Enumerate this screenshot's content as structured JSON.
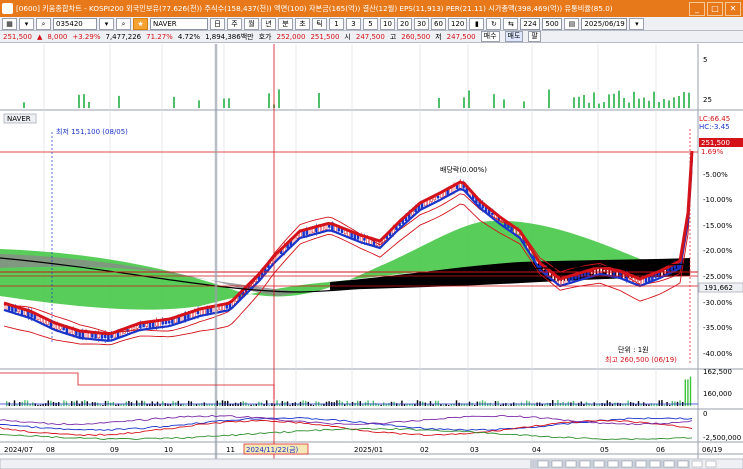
{
  "window": {
    "title": "[0600] 키움종합차트 - KOSPI200 외국인보유(77.626(천)) 주식수(158,437(천)) 액면(100) 자본금(165(억)) 결산(12월) EPS(11,913) PER(21.11) 시가총액(398,469(억)) 유통비율(85.0)",
    "buttons": [
      "_",
      "□",
      "✕"
    ]
  },
  "toolbar": {
    "code": "035420",
    "name": "NAVER",
    "period_buttons": [
      "주",
      "월",
      "년",
      "분",
      "초",
      "틱"
    ],
    "minute_buttons": [
      "1",
      "3",
      "5",
      "10",
      "20",
      "30",
      "60",
      "120"
    ],
    "count": "224",
    "count_total": "500",
    "date": "2025/06/19"
  },
  "quote": {
    "price": "251,500",
    "change": "8,000",
    "change_pct": "+3.29%",
    "volume": "7,477,226",
    "ratio": "71.27%",
    "turnover": "4.72%",
    "amount": "1,894,386백만",
    "label_ho": "호가",
    "ho_sell": "252,000",
    "ho_buy": "251,500",
    "label_si": "시",
    "open": "247,500",
    "label_go": "고",
    "high": "260,500",
    "label_jeo": "저",
    "low": "247,500",
    "btn_buy": "매수",
    "btn_sell": "매도",
    "btn_menu": "팔"
  },
  "chart": {
    "stock_label": "NAVER",
    "low_annotation": "최저 151,100 (08/05)",
    "high_annotation": "최고 260,500 (06/19)",
    "dividend_annotation": "배당락(0.00%)",
    "unit_annotation": "단위 : 1원",
    "lc_label": "LC:66.45",
    "hc_label": "HC:-3.45",
    "current_price_tag": "251,500",
    "current_pct_tag": "1.69%",
    "ma_value_tag": "191,662",
    "date_tag": "2024/11/22(금)",
    "top_axis": [
      "5",
      "25"
    ],
    "price_axis": [
      "-5.00%",
      "-10.00%",
      "-15.00%",
      "-20.00%",
      "-25.00%",
      "-30.00%",
      "-35.00%",
      "-40.00%"
    ],
    "volume_axis": [
      "162,500",
      "160,000"
    ],
    "bottom_axis": [
      "0",
      "-2,500,000"
    ],
    "x_axis": [
      "2024/07",
      "08",
      "09",
      "10",
      "11",
      "2025/01",
      "02",
      "03",
      "04",
      "05",
      "06",
      "06/19"
    ],
    "colors": {
      "accent": "#e8791b",
      "up": "#d4121a",
      "down": "#1a33c8",
      "cloud_green": "#3cc43c",
      "cloud_gray": "#8a8a8a",
      "cloud_black": "#000000"
    }
  }
}
